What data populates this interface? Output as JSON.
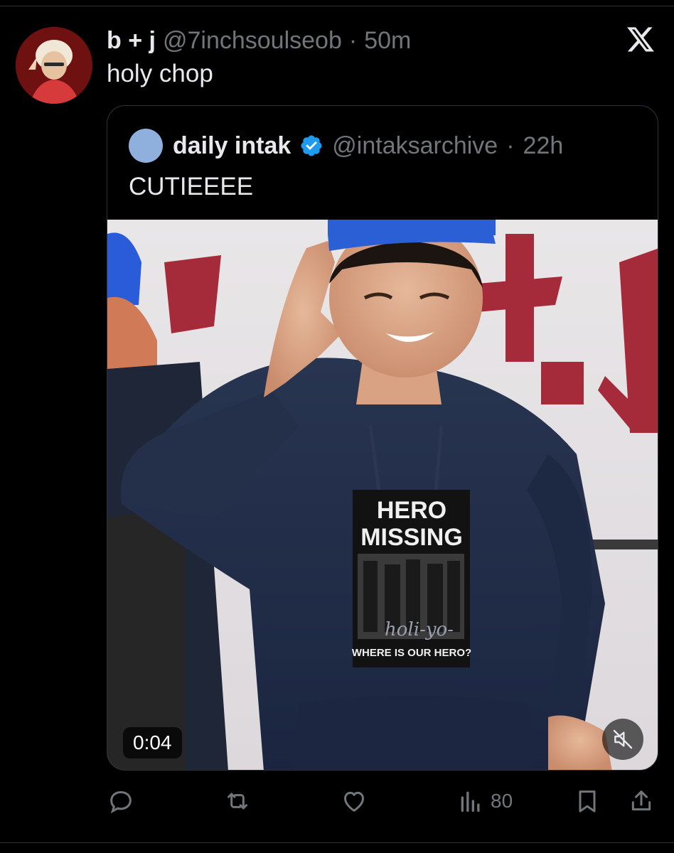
{
  "tweet": {
    "display_name": "b + j",
    "handle": "@7inchsoulseob",
    "separator": "·",
    "time": "50m",
    "text": "holy chop",
    "avatar_icon": "user-avatar",
    "platform_icon": "x-logo-icon"
  },
  "quoted": {
    "display_name": "daily intak",
    "verified": true,
    "handle": "@intaksarchive",
    "separator": "·",
    "time": "22h",
    "text": "CUTIEEEE",
    "media": {
      "type": "video",
      "duration": "0:04",
      "muted": true,
      "shirt_text_top": "HERO",
      "shirt_text_mid": "MISSING",
      "shirt_text_bottom": "WHERE IS OUR HERO?",
      "shirt_script": "holi-yo-"
    }
  },
  "actions": {
    "reply_icon": "reply-icon",
    "retweet_icon": "retweet-icon",
    "like_icon": "heart-icon",
    "views_icon": "views-icon",
    "views_count": "80",
    "bookmark_icon": "bookmark-icon",
    "share_icon": "share-icon"
  },
  "colors": {
    "background": "#000000",
    "text_primary": "#e7e9ea",
    "text_secondary": "#71767b",
    "border": "#2f3336",
    "verified_blue": "#1d9bf0"
  }
}
